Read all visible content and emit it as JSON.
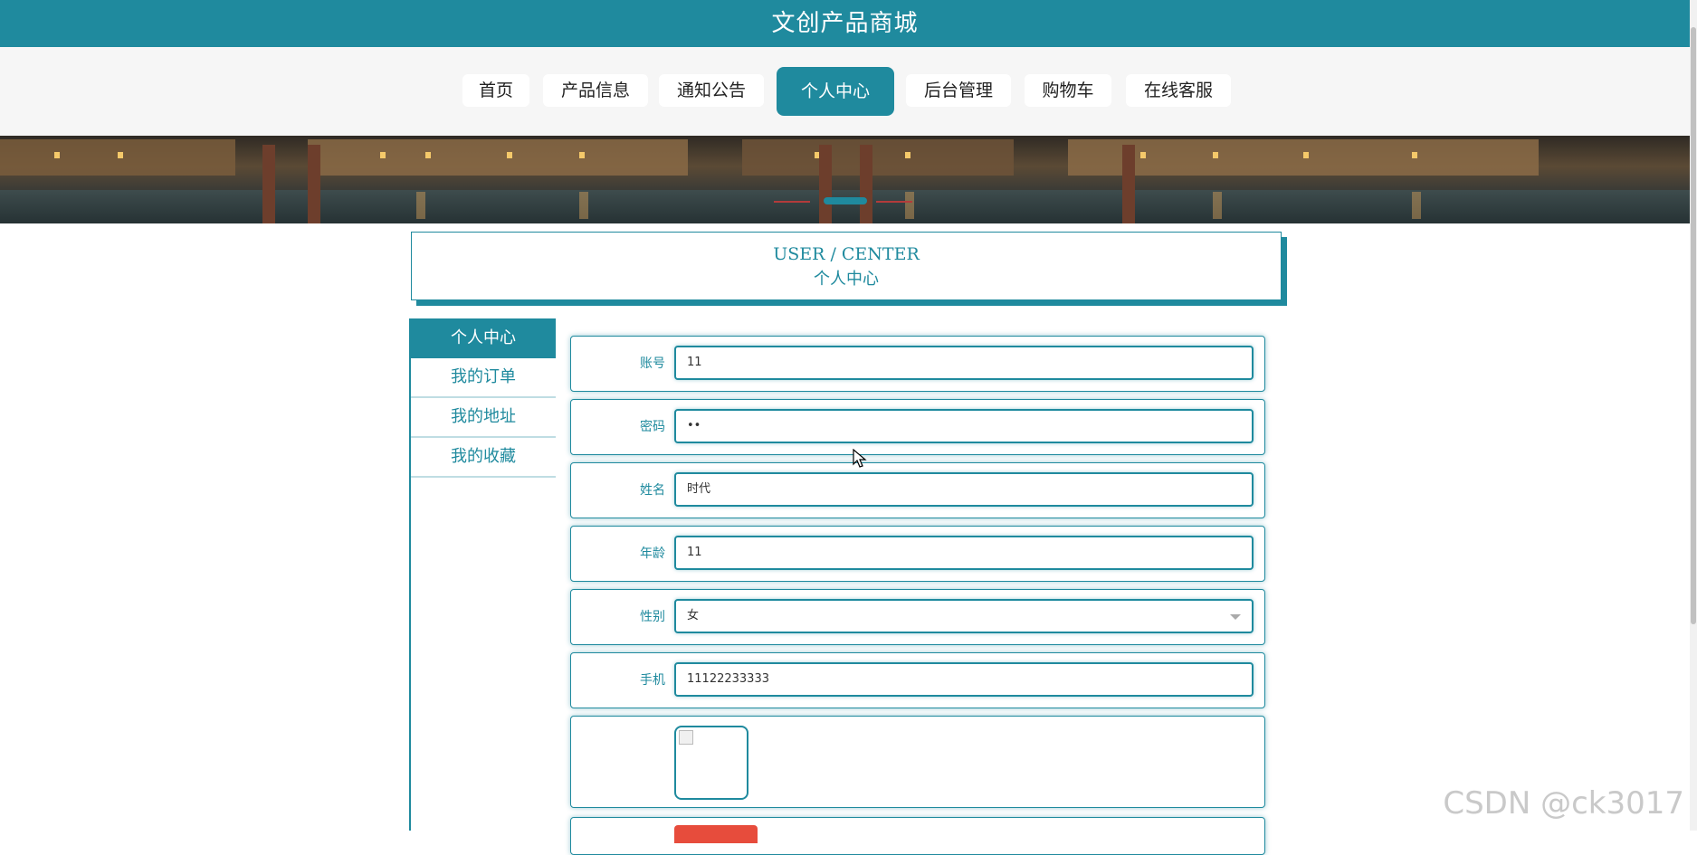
{
  "header": {
    "title": "文创产品商城"
  },
  "nav": {
    "items": [
      {
        "label": "首页"
      },
      {
        "label": "产品信息"
      },
      {
        "label": "通知公告"
      },
      {
        "label": "个人中心",
        "active": true
      },
      {
        "label": "后台管理"
      },
      {
        "label": "购物车"
      },
      {
        "label": "在线客服"
      }
    ]
  },
  "section": {
    "title_en": "USER / CENTER",
    "title_cn": "个人中心"
  },
  "sidebar": {
    "items": [
      {
        "label": "个人中心",
        "active": true
      },
      {
        "label": "我的订单"
      },
      {
        "label": "我的地址"
      },
      {
        "label": "我的收藏"
      }
    ]
  },
  "form": {
    "account": {
      "label": "账号",
      "value": "11"
    },
    "password": {
      "label": "密码",
      "value": "••"
    },
    "name": {
      "label": "姓名",
      "value": "时代"
    },
    "age": {
      "label": "年龄",
      "value": "11"
    },
    "gender": {
      "label": "性别",
      "value": "女"
    },
    "phone": {
      "label": "手机",
      "value": "11122233333"
    }
  },
  "watermark": "CSDN @ck3017",
  "colors": {
    "accent": "#1f8a9e",
    "danger": "#e74c3c"
  }
}
